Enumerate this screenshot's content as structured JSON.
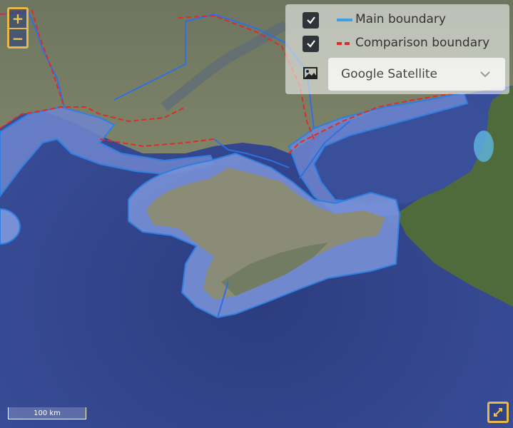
{
  "map": {
    "basemap": "satellite",
    "colors": {
      "sea": "#34478f",
      "land": "#6d7a5c",
      "buffer_fill": "#6f86cf",
      "main_boundary": "#2f7fe0",
      "comparison_boundary": "#e02a2a",
      "lagoon": "#5fb6e0"
    }
  },
  "zoom": {
    "in_label": "+",
    "out_label": "−"
  },
  "layers": [
    {
      "label": "Main boundary",
      "checked": true,
      "color": "#3aa0e8",
      "style": "solid"
    },
    {
      "label": "Comparison boundary",
      "checked": true,
      "color": "#e02a2a",
      "style": "dashed"
    }
  ],
  "basemap_select": {
    "icon": "image-icon",
    "selected": "Google Satellite"
  },
  "scale_bar": {
    "label": "100 km"
  },
  "fullscreen": {
    "icon": "expand-icon"
  }
}
